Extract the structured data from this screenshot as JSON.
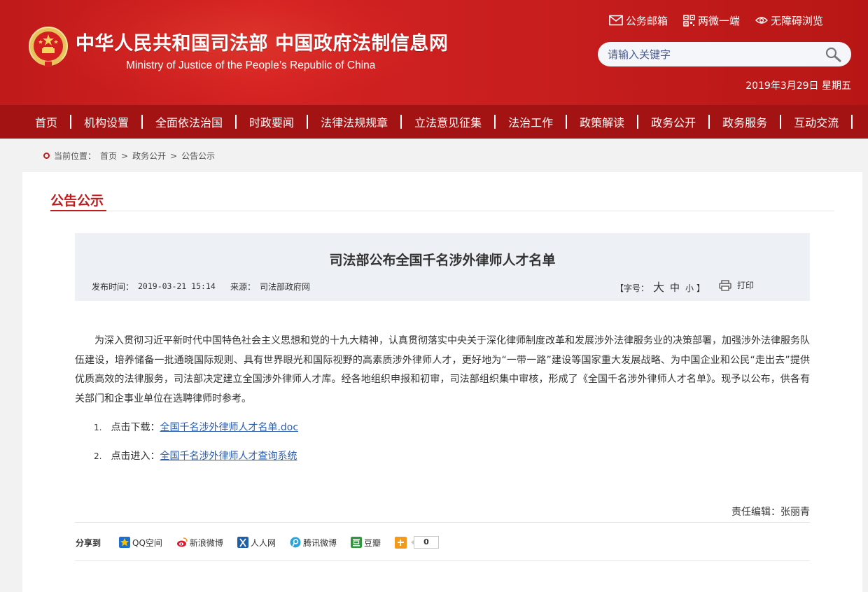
{
  "header": {
    "title": "中华人民共和国司法部  中国政府法制信息网",
    "subtitle": "Ministry of Justice of the People’s Republic of China",
    "links": [
      {
        "label": "公务邮箱",
        "icon": "mail-icon"
      },
      {
        "label": "两微一端",
        "icon": "qrcode-icon"
      },
      {
        "label": "无障碍浏览",
        "icon": "eye-icon"
      }
    ],
    "search_placeholder": "请输入关键字",
    "date": "2019年3月29日 星期五"
  },
  "nav": {
    "items": [
      "首页",
      "机构设置",
      "全面依法治国",
      "时政要闻",
      "法律法规规章",
      "立法意见征集",
      "法治工作",
      "政策解读",
      "政务公开",
      "政务服务",
      "互动交流"
    ]
  },
  "breadcrumb": {
    "prefix": "当前位置：",
    "items": [
      "首页",
      "政务公开",
      "公告公示"
    ],
    "separator": ">"
  },
  "section": {
    "title": "公告公示"
  },
  "article": {
    "title": "司法部公布全国千名涉外律师人才名单",
    "publish_label": "发布时间：",
    "publish_time": "2019-03-21 15:14",
    "source_label": "来源：",
    "source": "司法部政府网",
    "fontsize_open": "【字号：",
    "fontsize_large": "大",
    "fontsize_mid": "中",
    "fontsize_small": "小",
    "fontsize_close": "】",
    "print_label": "打印",
    "body": "为深入贯彻习近平新时代中国特色社会主义思想和党的十九大精神，认真贯彻落实中央关于深化律师制度改革和发展涉外法律服务业的决策部署，加强涉外法律服务队伍建设，培养储备一批通晓国际规则、具有世界眼光和国际视野的高素质涉外律师人才，更好地为“一带一路”建设等国家重大发展战略、为中国企业和公民“走出去”提供优质高效的法律服务，司法部决定建立全国涉外律师人才库。经各地组织申报和初审，司法部组织集中审核，形成了《全国千名涉外律师人才名单》。现予以公布，供各有关部门和企事业单位在选聘律师时参考。",
    "items": [
      {
        "num": "1.",
        "prefix": "点击下载：",
        "link": "全国千名涉外律师人才名单.doc"
      },
      {
        "num": "2.",
        "prefix": "点击进入：",
        "link": "全国千名涉外律师人才查询系统"
      }
    ],
    "editor": "责任编辑：张丽青"
  },
  "share": {
    "label": "分享到",
    "items": [
      {
        "label": "QQ空间",
        "color": "#f5b400"
      },
      {
        "label": "新浪微博",
        "color": "#e6162d"
      },
      {
        "label": "人人网",
        "color": "#1f5fa8"
      },
      {
        "label": "腾讯微博",
        "color": "#2ba3d8"
      },
      {
        "label": "豆瓣",
        "color": "#2e963d"
      }
    ],
    "count": "0"
  }
}
